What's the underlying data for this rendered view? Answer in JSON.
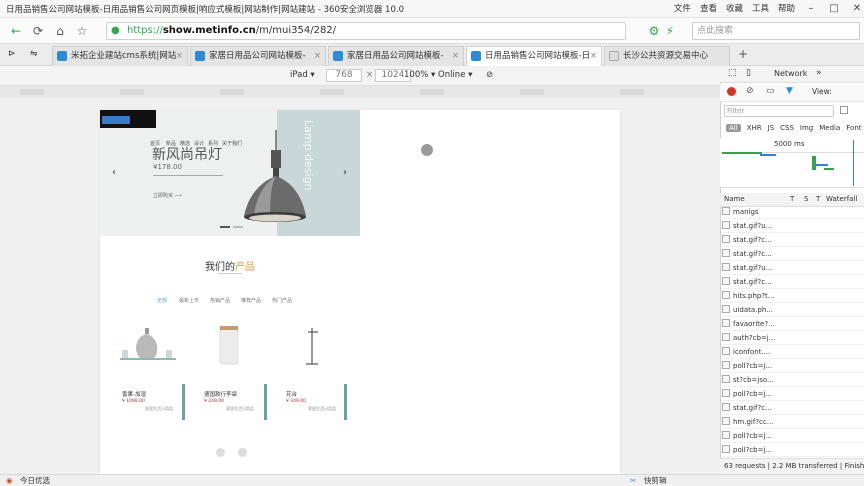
{
  "browser": {
    "window_title": "日用品销售公司网站模板-日用品销售公司网页模板|响应式模板|网站制作|网站建站 - 360安全浏览器 10.0",
    "menus": [
      "文件",
      "查看",
      "收藏",
      "工具",
      "帮助"
    ],
    "url_scheme": "https://",
    "url_host": "show.metinfo.cn",
    "url_path": "/m/mui354/282/",
    "search_placeholder": "点此搜索",
    "tabs": [
      {
        "label": "米拓企业建站cms系统|网站"
      },
      {
        "label": "家居日用品公司网站模板-"
      },
      {
        "label": "家居日用品公司网站模板-"
      },
      {
        "label": "日用品销售公司网站模板-日",
        "active": true
      },
      {
        "label": "长沙公共资源交易中心"
      }
    ]
  },
  "device_toolbar": {
    "device": "iPad",
    "width": "768",
    "height": "1024",
    "zoom": "100%",
    "network": "Online"
  },
  "site": {
    "banner": {
      "nav": [
        "首页",
        "新品",
        "精选",
        "设计",
        "系列",
        "关于我们"
      ],
      "title": "新风尚吊灯",
      "price": "¥178.00",
      "more": "立即购买",
      "vertical_text": "Lamp design"
    },
    "section_title_a": "我们的",
    "section_title_b": "产品",
    "categories": [
      "全部",
      "最新上市",
      "热销产品",
      "推荐产品",
      "热门产品"
    ],
    "products": [
      {
        "name": "香薰-加湿",
        "price": "¥ 1098.00",
        "desc": "家居生活日用品"
      },
      {
        "name": "德国款行李袋",
        "price": "¥ 249.00",
        "desc": "家居生活日用品"
      },
      {
        "name": "花台",
        "price": "¥ 349.00",
        "desc": "家居生活日用品"
      }
    ]
  },
  "devtools": {
    "tab": "Network",
    "filter_placeholder": "Filter",
    "types": [
      "All",
      "XHR",
      "JS",
      "CSS",
      "Img",
      "Media",
      "Font"
    ],
    "timeline_label": "5000 ms",
    "columns": [
      "Name",
      "T",
      "S",
      "T",
      "Waterfall"
    ],
    "requests": [
      "manigs",
      "stat.gif?u...",
      "stat.gif?c...",
      "stat.gif?c...",
      "stat.gif?u...",
      "stat.gif?c...",
      "hits.php?t...",
      "uidata.ph...",
      "favaorite?...",
      "auth?cb=j...",
      "iconfont....",
      "poll?cb=j...",
      "st?cb=jso...",
      "poll?cb=j...",
      "stat.gif?c...",
      "hm.gif?cc...",
      "poll?cb=j...",
      "poll?cb=j..."
    ],
    "status_requests": "63 requests",
    "status_transferred": "2.2 MB transferred",
    "status_finish": "Finish"
  },
  "statusbar": {
    "left": "今日优选",
    "right": "快剪辑"
  }
}
